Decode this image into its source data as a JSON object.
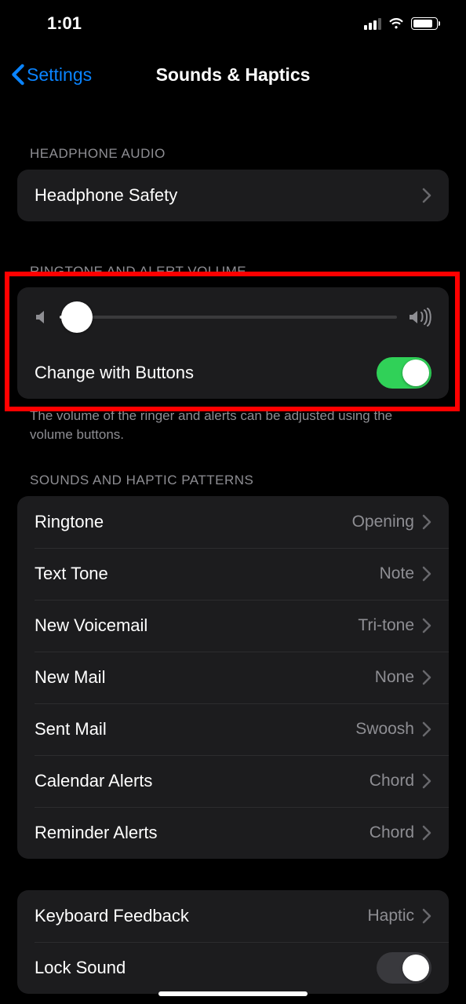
{
  "statusbar": {
    "time": "1:01"
  },
  "nav": {
    "back_label": "Settings",
    "title": "Sounds & Haptics"
  },
  "sections": {
    "headphone_header": "HEADPHONE AUDIO",
    "headphone_safety": "Headphone Safety",
    "ringtone_header": "RINGTONE AND ALERT VOLUME",
    "change_with_buttons": "Change with Buttons",
    "ringtone_footer": "The volume of the ringer and alerts can be adjusted using the volume buttons.",
    "patterns_header": "SOUNDS AND HAPTIC PATTERNS",
    "patterns": [
      {
        "label": "Ringtone",
        "value": "Opening"
      },
      {
        "label": "Text Tone",
        "value": "Note"
      },
      {
        "label": "New Voicemail",
        "value": "Tri-tone"
      },
      {
        "label": "New Mail",
        "value": "None"
      },
      {
        "label": "Sent Mail",
        "value": "Swoosh"
      },
      {
        "label": "Calendar Alerts",
        "value": "Chord"
      },
      {
        "label": "Reminder Alerts",
        "value": "Chord"
      }
    ],
    "keyboard_feedback_label": "Keyboard Feedback",
    "keyboard_feedback_value": "Haptic",
    "lock_sound_label": "Lock Sound"
  },
  "toggles": {
    "change_with_buttons": true,
    "lock_sound": false
  },
  "slider": {
    "value_percent": 5
  },
  "annotation": {
    "highlight_box": true
  }
}
